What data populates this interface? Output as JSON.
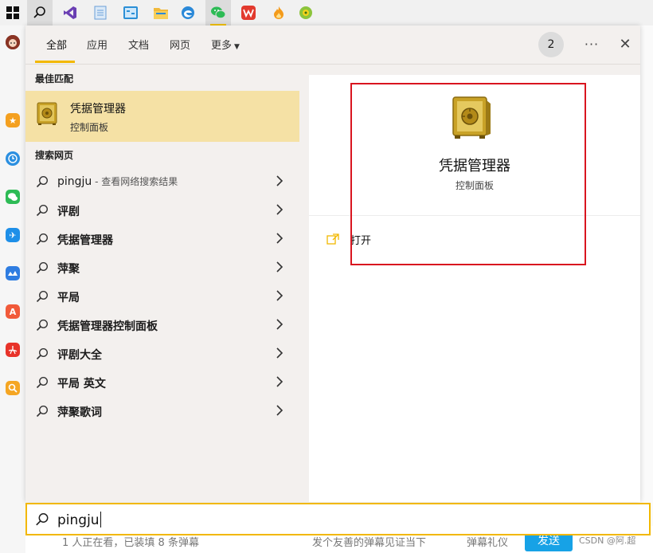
{
  "taskbar": {
    "icons": [
      {
        "name": "windows-start-icon",
        "color": "#111111"
      },
      {
        "name": "search-icon",
        "color": "#111111"
      },
      {
        "name": "visual-studio-icon",
        "color": "#6a3fb3"
      },
      {
        "name": "notepad-icon",
        "color": "#6aa0d8"
      },
      {
        "name": "control-panel-icon",
        "color": "#2b8fd6"
      },
      {
        "name": "file-explorer-icon",
        "color": "#f1b93a"
      },
      {
        "name": "edge-browser-icon",
        "color": "#2b89d8"
      },
      {
        "name": "wechat-icon",
        "color": "#2dbb55"
      },
      {
        "name": "wps-icon",
        "color": "#e23a2e"
      },
      {
        "name": "flame-app-icon",
        "color": "#f49b1b"
      },
      {
        "name": "orb-app-icon",
        "color": "#8cc43c"
      }
    ]
  },
  "tabs": {
    "all": "全部",
    "apps": "应用",
    "docs": "文档",
    "web": "网页",
    "more": "更多"
  },
  "header": {
    "count": "2",
    "more_dots": "···",
    "close": "✕"
  },
  "sections": {
    "best_match": "最佳匹配",
    "web_search": "搜索网页"
  },
  "best_match": {
    "title": "凭据管理器",
    "subtitle": "控制面板"
  },
  "results": [
    {
      "text": "pingju",
      "note": " - 查看网络搜索结果"
    },
    {
      "text": "评剧",
      "note": ""
    },
    {
      "text": "凭据管理器",
      "note": ""
    },
    {
      "text": "萍聚",
      "note": ""
    },
    {
      "text": "平局",
      "note": ""
    },
    {
      "text": "凭据管理器控制面板",
      "note": ""
    },
    {
      "text": "评剧大全",
      "note": ""
    },
    {
      "text": "平局 英文",
      "note": ""
    },
    {
      "text": "萍聚歌词",
      "note": ""
    }
  ],
  "preview": {
    "title": "凭据管理器",
    "subtitle": "控制面板",
    "open_label": "打开"
  },
  "search": {
    "query": "pingju"
  },
  "background_app": {
    "status_text": "1 人正在看，已装填 8 条弹幕",
    "danmaku_placeholder": "发个友善的弹幕见证当下",
    "etiquette": "弹幕礼仪",
    "send": "发送",
    "watermark": "CSDN @阿.超"
  },
  "colors": {
    "accent": "#f2b800",
    "selection": "#f5e1a5",
    "highlight_border": "#d9151f"
  }
}
